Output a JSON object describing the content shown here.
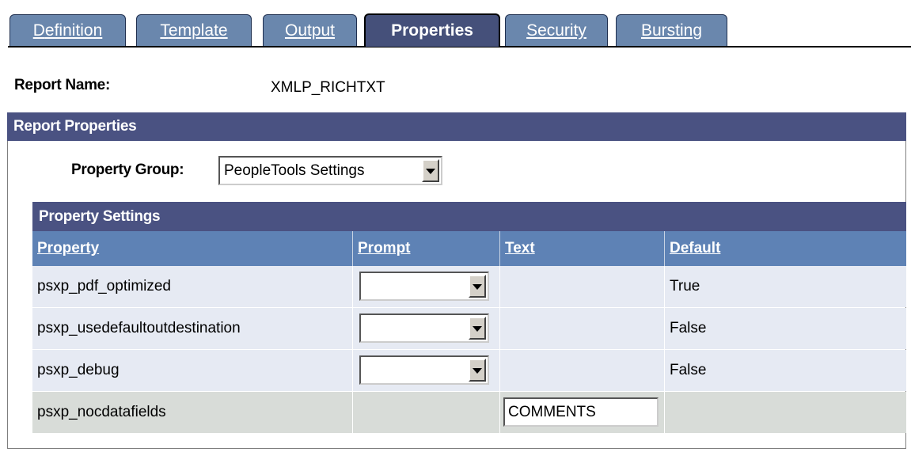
{
  "tabs": [
    {
      "accel": "D",
      "rest": "efinition",
      "active": false
    },
    {
      "accel": "T",
      "rest": "emplate",
      "active": false
    },
    {
      "accel": "O",
      "rest": "utput",
      "active": false
    },
    {
      "accel": "",
      "rest": "Properties",
      "active": true
    },
    {
      "accel": "S",
      "rest": "ecurity",
      "active": false
    },
    {
      "accel": "B",
      "rest": "ursting",
      "active": false
    }
  ],
  "report": {
    "name_label": "Report Name:",
    "name_value": "XMLP_RICHTXT"
  },
  "report_properties": {
    "header": "Report Properties",
    "group_label": "Property Group:",
    "group_value": "PeopleTools Settings"
  },
  "property_settings": {
    "title": "Property Settings",
    "columns": [
      "Property",
      "Prompt",
      "Text",
      "Default"
    ],
    "rows": [
      {
        "property": "psxp_pdf_optimized",
        "prompt": "",
        "text": "",
        "default": "True"
      },
      {
        "property": "psxp_usedefaultoutdestination",
        "prompt": "",
        "text": "",
        "default": "False"
      },
      {
        "property": "psxp_debug",
        "prompt": "",
        "text": "",
        "default": "False"
      },
      {
        "property": "psxp_nocdatafields",
        "prompt": "",
        "text": "COMMENTS",
        "default": ""
      }
    ]
  },
  "colors": {
    "tab": "#6a87ad",
    "tab_active": "#45507a",
    "section_header": "#4a5282",
    "grid_header": "#5e82b5",
    "row_alt": "#e6eaf3",
    "row_plain": "#d8dcd8"
  },
  "icons": {
    "dropdown": "chevron-down-icon"
  }
}
